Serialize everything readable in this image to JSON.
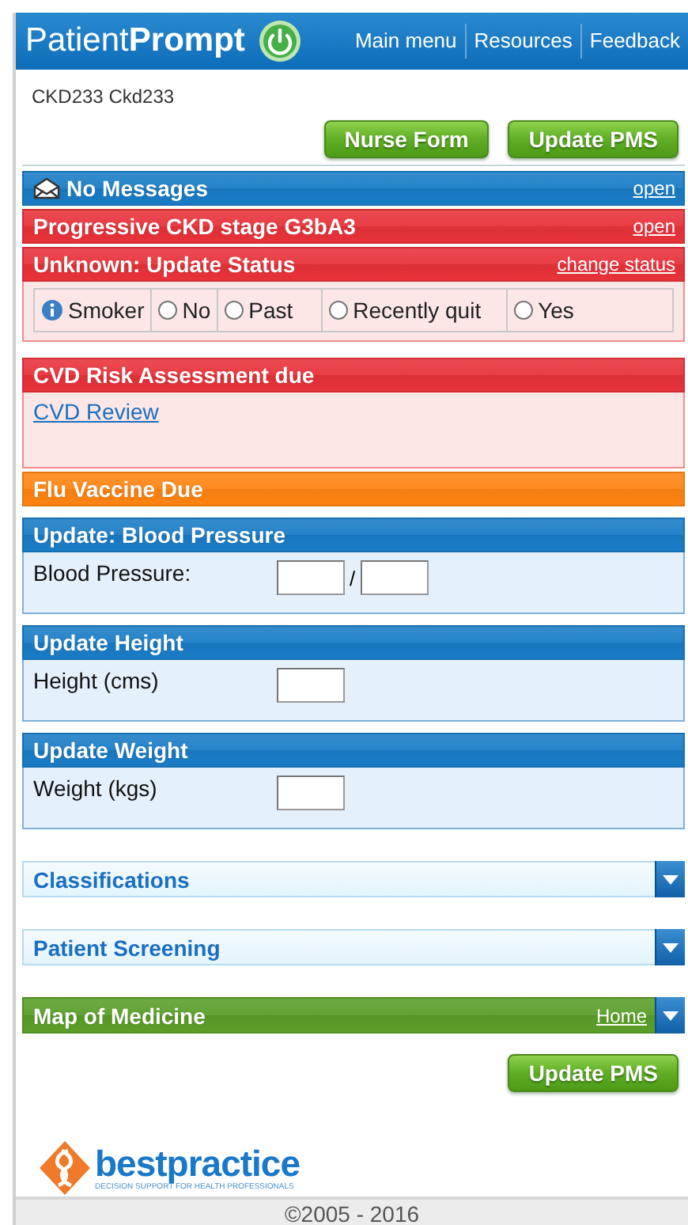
{
  "header": {
    "brand": "Patient**Prompt**",
    "nav": [
      {
        "label": "Main menu"
      },
      {
        "label": "Resources"
      },
      {
        "label": "Feedback"
      }
    ]
  },
  "patient_name": "CKD233 Ckd233",
  "top_buttons": [
    "Nurse Form",
    "Update PMS"
  ],
  "sections": [
    {
      "kind": "messages",
      "title": "No Messages",
      "link": "open",
      "color": "#1a7cc6"
    },
    {
      "kind": "alert",
      "title": "Progressive CKD stage G3bA3",
      "link": "open",
      "color": "#e8323a"
    },
    {
      "kind": "status",
      "title": "Unknown: Update Status",
      "link": "change status",
      "color": "#e8323a",
      "field": "Smoker",
      "options": [
        {
          "label": "No",
          "selected": false
        },
        {
          "label": "Past",
          "selected": false
        },
        {
          "label": "Recently quit",
          "selected": false
        },
        {
          "label": "Yes",
          "selected": false
        }
      ]
    },
    {
      "kind": "task",
      "title": "CVD Risk Assessment due",
      "color": "#e8323a",
      "links": [
        "CVD Review"
      ]
    },
    {
      "kind": "alert",
      "title": "Flu Vaccine Due",
      "color": "#ff8412"
    },
    {
      "kind": "form",
      "title": "Update: Blood Pressure",
      "color": "#1a7cc6",
      "label": "Blood Pressure:",
      "separator": "/"
    },
    {
      "kind": "form",
      "title": "Update Height",
      "color": "#1a7cc6",
      "label": "Height (cms)"
    },
    {
      "kind": "form",
      "title": "Update Weight",
      "color": "#1a7cc6",
      "label": "Weight (kgs)"
    },
    {
      "kind": "collapsible",
      "title": "Classifications",
      "color": "#e4f4fc",
      "expanded": false
    },
    {
      "kind": "collapsible",
      "title": "Patient Screening",
      "color": "#e4f4fc",
      "expanded": false
    },
    {
      "kind": "collapsible",
      "title": "Map of Medicine",
      "color": "#5a9e28",
      "link": "Home",
      "expanded": false
    }
  ],
  "bottom_button": "Update PMS",
  "logo": {
    "name": "bestpractice",
    "tagline": "DECISION SUPPORT FOR HEALTH PROFESSIONALS"
  },
  "footer": "©2005 - 2016"
}
